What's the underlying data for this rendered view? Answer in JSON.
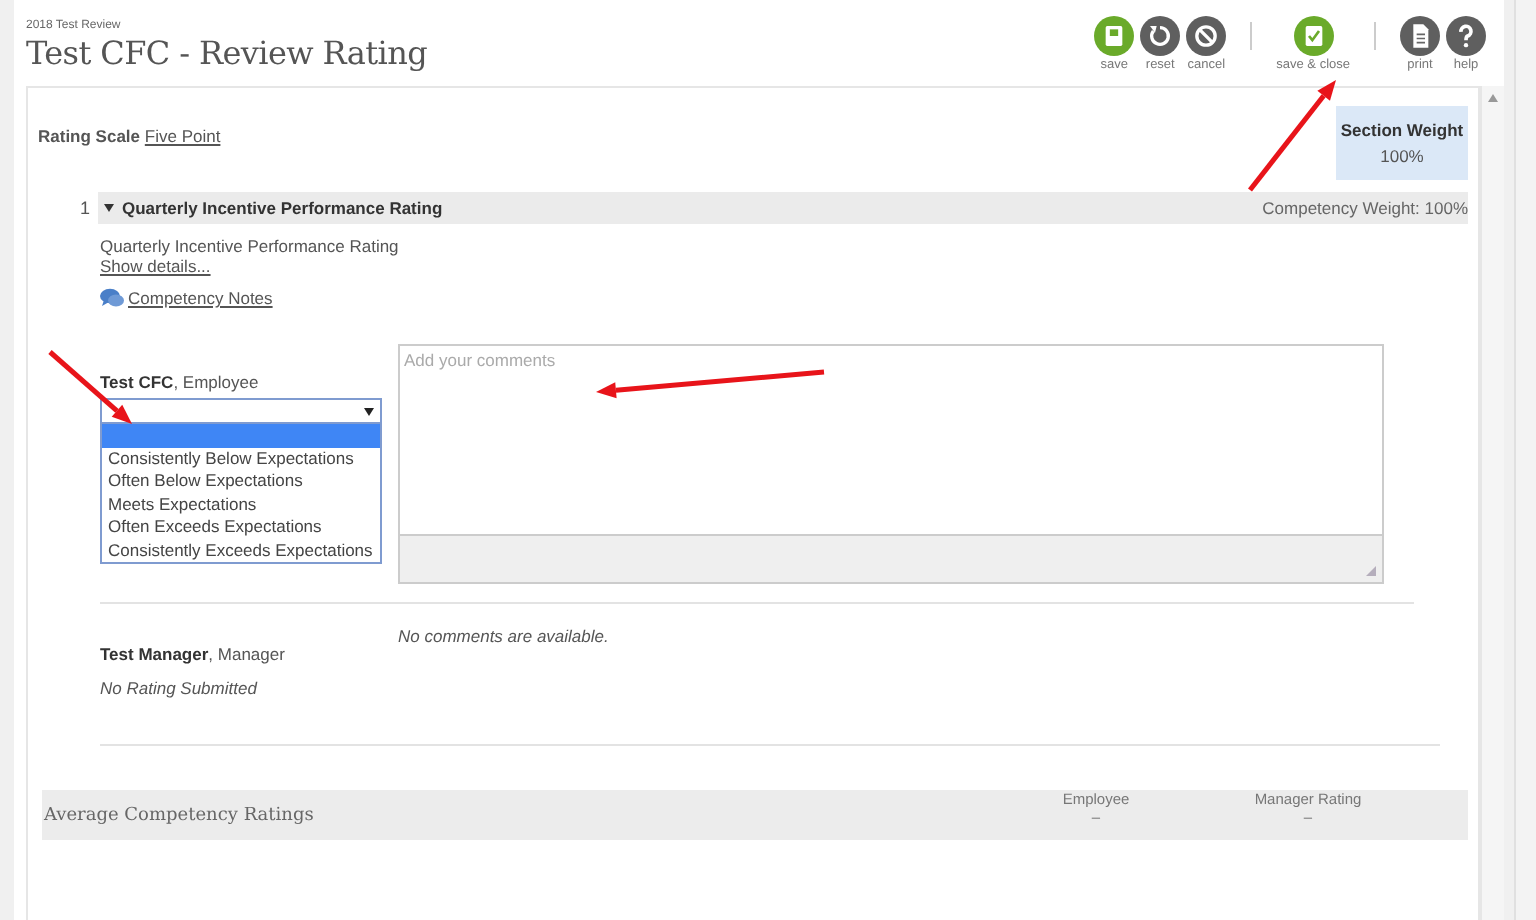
{
  "header": {
    "subtitle": "2018 Test Review",
    "title": "Test CFC - Review Rating"
  },
  "toolbar": [
    {
      "buttons": [
        {
          "kind": "save",
          "label": "save"
        },
        {
          "kind": "reset",
          "label": "reset"
        },
        {
          "kind": "cancel",
          "label": "cancel"
        }
      ]
    },
    {
      "buttons": [
        {
          "kind": "save_close",
          "label": "save & close"
        }
      ]
    },
    {
      "buttons": [
        {
          "kind": "print",
          "label": "print"
        },
        {
          "kind": "help",
          "label": "help"
        }
      ]
    }
  ],
  "rating_scale": {
    "label": "Rating Scale",
    "value": "Five Point"
  },
  "section_weight": {
    "label": "Section Weight",
    "value": "100%"
  },
  "competency": {
    "number": "1",
    "title": "Quarterly Incentive Performance Rating",
    "expanded": true,
    "weight": "Competency Weight: 100%",
    "description": "Quarterly Incentive Performance Rating",
    "show_details": "Show details...",
    "notes_link": "Competency Notes"
  },
  "employee": {
    "name": "Test CFC",
    "role": ", Employee",
    "dropdown": {
      "open": true,
      "options": [
        {
          "selected": true
        },
        {
          "label": "Consistently Below Expectations",
          "selected": false
        },
        {
          "label": "Often Below Expectations",
          "selected": false
        },
        {
          "label": "Meets Expectations",
          "selected": false
        },
        {
          "label": "Often Exceeds Expectations",
          "selected": false
        },
        {
          "label": "Consistently Exceeds Expectations",
          "selected": false
        }
      ]
    },
    "comments": {
      "placeholder": "Add your comments"
    }
  },
  "manager": {
    "name": "Test Manager",
    "role": ", Manager",
    "status": "No Rating Submitted",
    "comments": "No comments are available."
  },
  "averages": {
    "title": "Average Competency Ratings",
    "columns": [
      {
        "label": "Employee",
        "value": "–"
      },
      {
        "label": "Manager Rating",
        "value": "–"
      }
    ]
  }
}
